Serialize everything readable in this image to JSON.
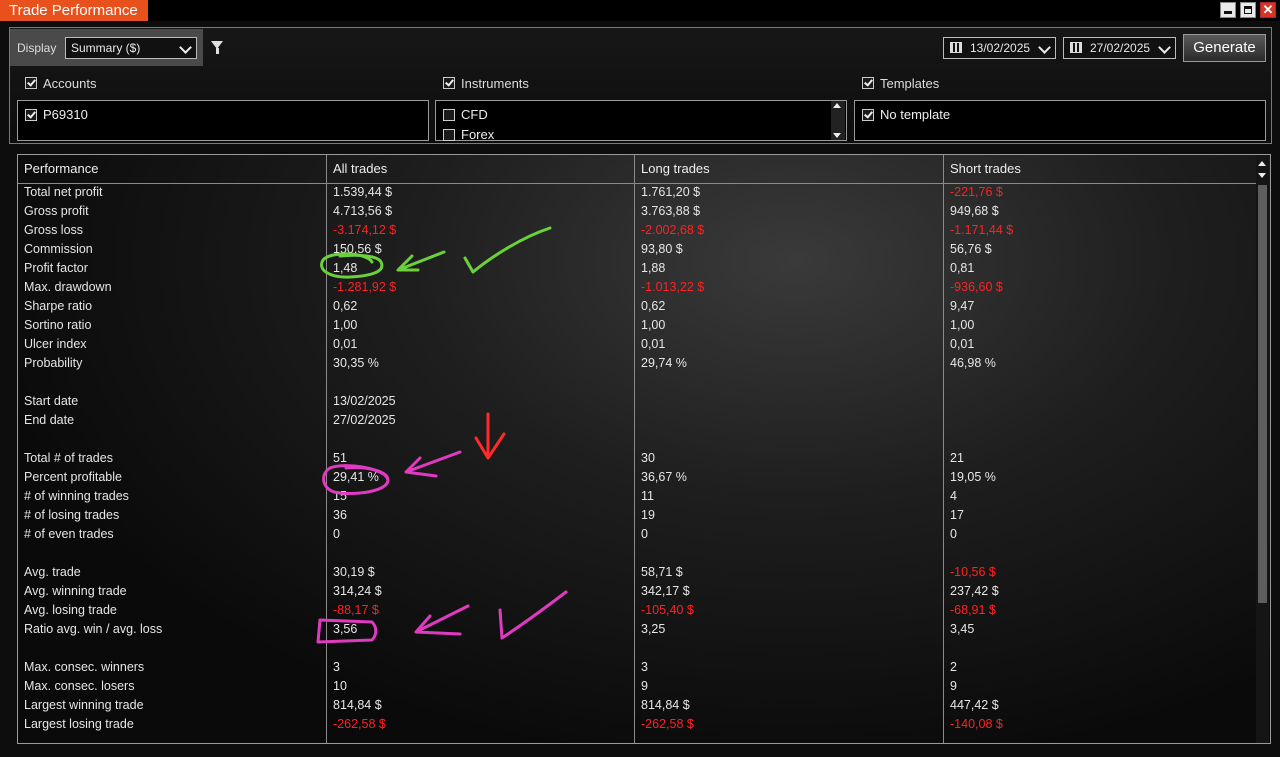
{
  "window": {
    "title": "Trade Performance",
    "close_glyph": "✕"
  },
  "toolbar": {
    "display_label": "Display",
    "display_value": "Summary ($)",
    "date_from": "13/02/2025",
    "date_to": "27/02/2025",
    "generate_label": "Generate"
  },
  "filters": {
    "accounts": {
      "label": "Accounts",
      "items": [
        "P69310"
      ]
    },
    "instruments": {
      "label": "Instruments",
      "items": [
        "CFD",
        "Forex"
      ]
    },
    "templates": {
      "label": "Templates",
      "items": [
        "No template"
      ]
    }
  },
  "grid": {
    "headers": [
      "Performance",
      "All trades",
      "Long trades",
      "Short trades"
    ],
    "rows": [
      [
        "Total net profit",
        "1.539,44 $",
        "1.761,20 $",
        "-221,76 $"
      ],
      [
        "Gross profit",
        "4.713,56 $",
        "3.763,88 $",
        "949,68 $"
      ],
      [
        "Gross loss",
        "-3.174,12 $",
        "-2.002,68 $",
        "-1.171,44 $"
      ],
      [
        "Commission",
        "150,56 $",
        "93,80 $",
        "56,76 $"
      ],
      [
        "Profit factor",
        "1,48",
        "1,88",
        "0,81"
      ],
      [
        "Max. drawdown",
        "-1.281,92 $",
        "-1.013,22 $",
        "-936,60 $"
      ],
      [
        "Sharpe ratio",
        "0,62",
        "0,62",
        "9,47"
      ],
      [
        "Sortino ratio",
        "1,00",
        "1,00",
        "1,00"
      ],
      [
        "Ulcer index",
        "0,01",
        "0,01",
        "0,01"
      ],
      [
        "Probability",
        "30,35 %",
        "29,74 %",
        "46,98 %"
      ],
      [
        "",
        "",
        "",
        ""
      ],
      [
        "Start date",
        "13/02/2025",
        "",
        ""
      ],
      [
        "End date",
        "27/02/2025",
        "",
        ""
      ],
      [
        "",
        "",
        "",
        ""
      ],
      [
        "Total # of trades",
        "51",
        "30",
        "21"
      ],
      [
        "Percent profitable",
        "29,41 %",
        "36,67 %",
        "19,05 %"
      ],
      [
        "# of winning trades",
        "15",
        "11",
        "4"
      ],
      [
        "# of losing trades",
        "36",
        "19",
        "17"
      ],
      [
        "# of even trades",
        "0",
        "0",
        "0"
      ],
      [
        "",
        "",
        "",
        ""
      ],
      [
        "Avg. trade",
        "30,19 $",
        "58,71 $",
        "-10,56 $"
      ],
      [
        "Avg. winning trade",
        "314,24 $",
        "342,17 $",
        "237,42 $"
      ],
      [
        "Avg. losing trade",
        "-88,17 $",
        "-105,40 $",
        "-68,91 $"
      ],
      [
        "Ratio avg. win / avg. loss",
        "3,56",
        "3,25",
        "3,45"
      ],
      [
        "",
        "",
        "",
        ""
      ],
      [
        "Max. consec. winners",
        "3",
        "3",
        "2"
      ],
      [
        "Max. consec. losers",
        "10",
        "9",
        "9"
      ],
      [
        "Largest winning trade",
        "814,84 $",
        "814,84 $",
        "447,42 $"
      ],
      [
        "Largest losing trade",
        "-262,58 $",
        "-262,58 $",
        "-140,08 $"
      ]
    ]
  },
  "colors": {
    "title_tab": "#e8501c",
    "negative": "#ff2222",
    "annotation_green": "#6ad13a",
    "annotation_pink": "#e03ac0",
    "annotation_red": "#ff2a2a"
  }
}
